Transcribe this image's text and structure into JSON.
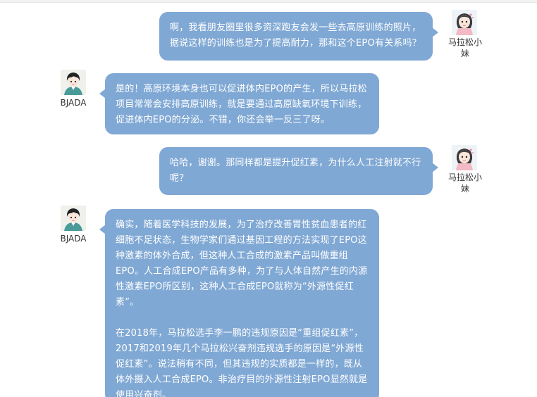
{
  "messages": [
    {
      "sender": "马拉松小妹",
      "side": "right",
      "name_line1": "马拉松小",
      "name_line2": "妹",
      "text": "啊，我看朋友圈里很多资深跑友会发一些去高原训练的照片，据说这样的训练也是为了提高耐力，那和这个EPO有关系吗？"
    },
    {
      "sender": "BJADA",
      "side": "left",
      "name_line1": "BJADA",
      "text": "是的！高原环境本身也可以促进体内EPO的产生，所以马拉松项目常常会安排高原训练，就是要通过高原缺氧环境下训练，促进体内EPO的分泌。不错，你还会举一反三了呀。"
    },
    {
      "sender": "马拉松小妹",
      "side": "right",
      "name_line1": "马拉松小",
      "name_line2": "妹",
      "text": "哈哈，谢谢。那同样都是提升促红素，为什么人工注射就不行呢？"
    },
    {
      "sender": "BJADA",
      "side": "left",
      "name_line1": "BJADA",
      "paragraph1": "确实，随着医学科技的发展，为了治疗改善胃性贫血患者的红细胞不足状态，生物学家们通过基因工程的方法实现了EPO这种激素的体外合成，但这种人工合成的激素产品叫做重组EPO。人工合成EPO产品有多种，为了与人体自然产生的内源性激素EPO所区别，这种人工合成EPO就称为“外源性促红素”。",
      "paragraph2": "在2018年，马拉松选手李一鹏的违规原因是“重组促红素”，2017和2019年几个马拉松兴奋剂违规选手的原因是“外源性促红素”。说法稍有不同，但其违规的实质都是一样的，既从体外摄入人工合成EPO。非治疗目的外源性注射EPO显然就是使用兴奋剂。"
    }
  ],
  "colors": {
    "bubble": "#80a8d4",
    "bubble_text": "#ffffff",
    "name_text": "#333333"
  },
  "icons": {
    "girl_avatar": "girl-avatar-icon",
    "boy_avatar": "boy-avatar-icon"
  }
}
